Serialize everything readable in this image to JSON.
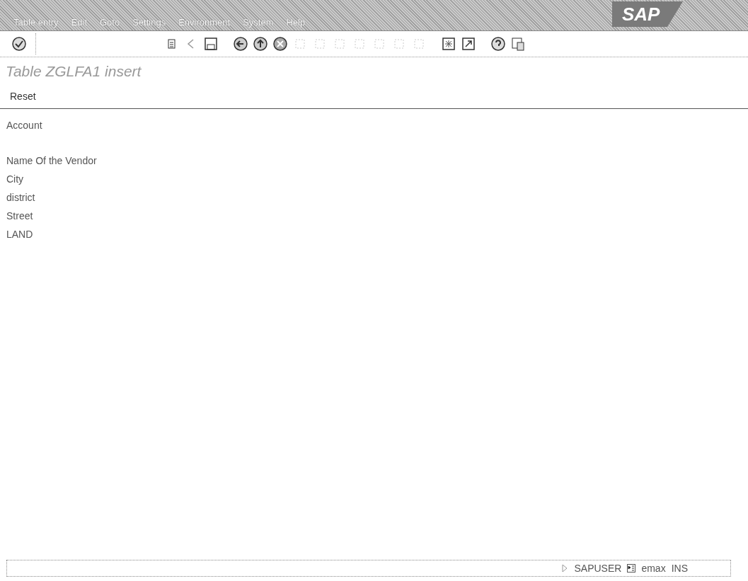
{
  "menu_bar": {
    "items": [
      "Table entry",
      "Edit",
      "Goto",
      "Settings",
      "Environment",
      "System",
      "Help"
    ],
    "logo": "SAP"
  },
  "toolbar": {
    "icons": [
      {
        "kind": "check"
      },
      {
        "kind": "gap"
      },
      {
        "kind": "list"
      },
      {
        "kind": "back-arrow"
      },
      {
        "kind": "save"
      },
      {
        "kind": "spacer"
      },
      {
        "kind": "back"
      },
      {
        "kind": "up"
      },
      {
        "kind": "cancel"
      },
      {
        "kind": "faded"
      },
      {
        "kind": "faded"
      },
      {
        "kind": "faded"
      },
      {
        "kind": "faded"
      },
      {
        "kind": "faded"
      },
      {
        "kind": "faded"
      },
      {
        "kind": "faded"
      },
      {
        "kind": "spacer"
      },
      {
        "kind": "session"
      },
      {
        "kind": "shortcut"
      },
      {
        "kind": "spacer"
      },
      {
        "kind": "help"
      },
      {
        "kind": "layout"
      }
    ]
  },
  "screen_title": "Table ZGLFA1 insert",
  "app_toolbar": {
    "buttons": [
      "Reset"
    ]
  },
  "fields": [
    {
      "label": "Account"
    },
    {
      "label": "Name Of the Vendor"
    },
    {
      "label": "City"
    },
    {
      "label": "district"
    },
    {
      "label": "Street"
    },
    {
      "label": "LAND"
    }
  ],
  "status_bar": {
    "user": "SAPUSER",
    "server": "emax",
    "mode": "INS"
  }
}
